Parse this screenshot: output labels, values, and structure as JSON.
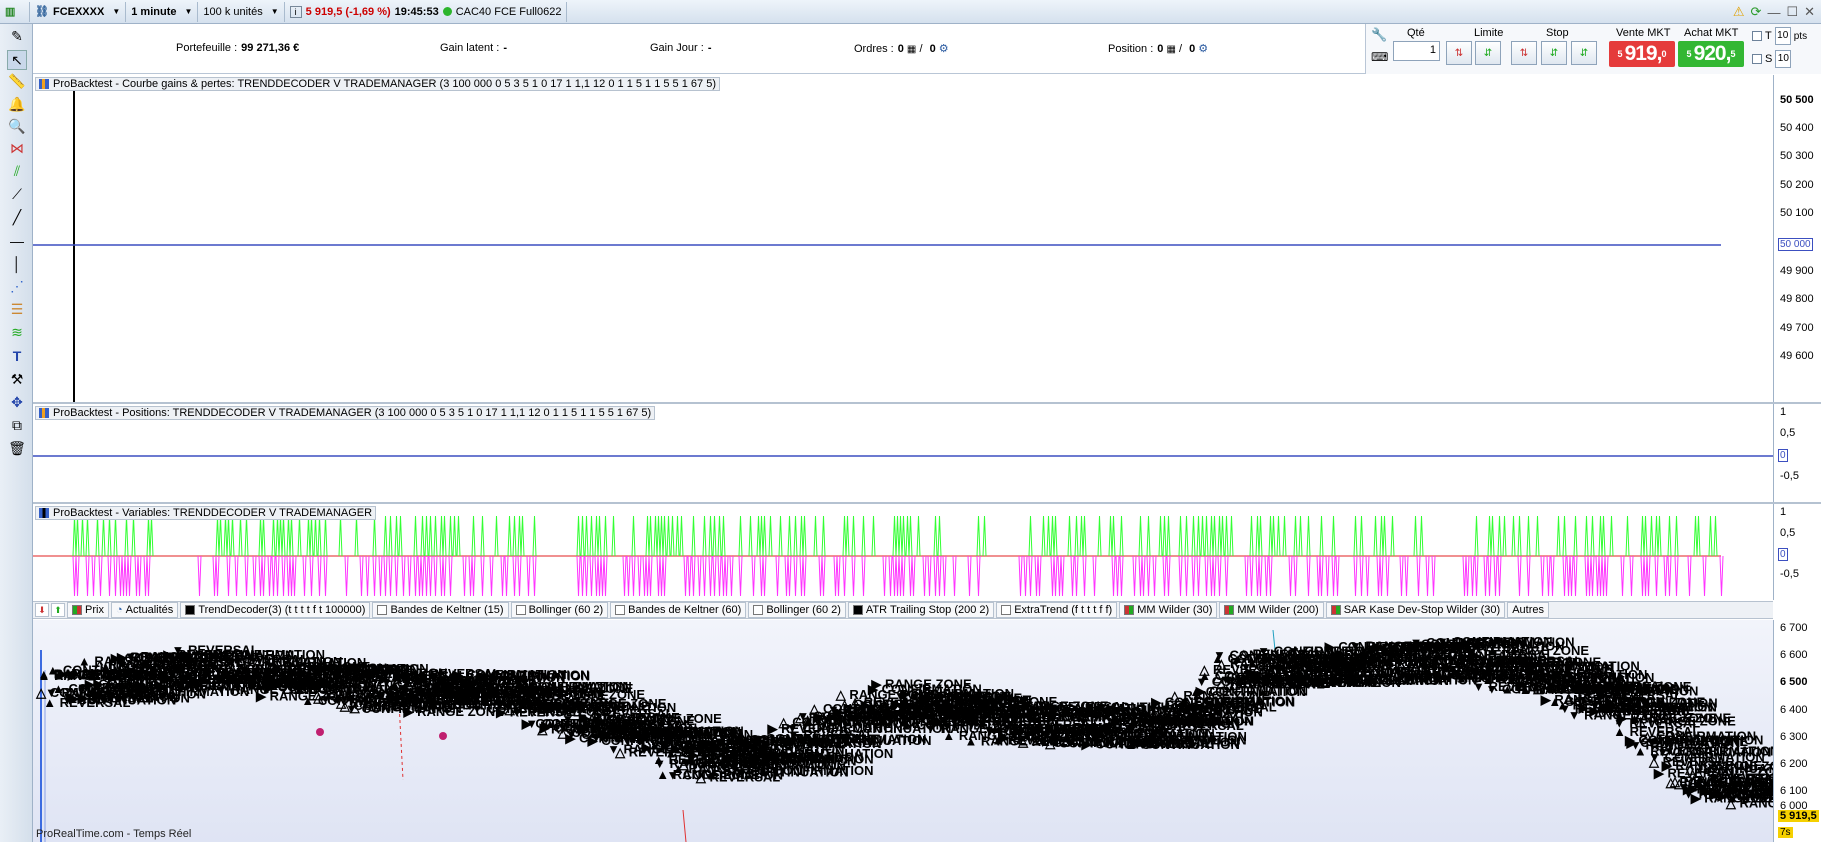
{
  "topbar": {
    "symbol": "FCEXXXX",
    "timeframe": "1 minute",
    "units": "100 k unités",
    "info_icon": "i",
    "price_change": "5 919,5 (-1,69 %)",
    "time": "19:45:53",
    "instrument": "CAC40 FCE Full0622"
  },
  "infobar": {
    "portefeuille_label": "Portefeuille :",
    "portefeuille_value": "99 271,36 €",
    "gain_latent_label": "Gain latent :",
    "gain_latent_value": "-",
    "gain_jour_label": "Gain Jour :",
    "gain_jour_value": "-",
    "ordres_label": "Ordres :",
    "ordres_value_1": "0",
    "ordres_sep": "/",
    "ordres_value_2": "0",
    "position_label": "Position :",
    "position_value_1": "0",
    "position_sep": "/",
    "position_value_2": "0"
  },
  "order_panel": {
    "qty_label": "Qté",
    "qty_value": "1",
    "limit_label": "Limite",
    "stop_label": "Stop",
    "sell_label": "Vente MKT",
    "sell_prefix": "5",
    "sell_main": "919,",
    "sell_sup": "0",
    "buy_label": "Achat MKT",
    "buy_prefix": "5",
    "buy_main": "920,",
    "buy_sup": "5",
    "t_label": "T",
    "s_label": "S",
    "t_value": "10",
    "s_value": "10",
    "pts_label": "pts"
  },
  "panels": {
    "equity": {
      "title": "ProBacktest - Courbe gains & pertes: TRENDDECODER V TRADEMANAGER (3 100 000 0 5 3 5 1 0 17 1 1,1 12 0 1 1 5 1 1 5 5 1 67 5)",
      "ticks": [
        "50 500",
        "50 400",
        "50 300",
        "50 200",
        "50 100",
        "50 000",
        "49 900",
        "49 800",
        "49 700",
        "49 600"
      ],
      "current_value": "50 000"
    },
    "positions": {
      "title": "ProBacktest - Positions: TRENDDECODER V TRADEMANAGER (3 100 000 0 5 3 5 1 0 17 1 1,1 12 0 1 1 5 1 1 5 5 1 67 5)",
      "ticks": [
        "1",
        "0,5",
        "-0,5"
      ],
      "current_value": "0"
    },
    "variables": {
      "title": "ProBacktest - Variables: TRENDDECODER V TRADEMANAGER",
      "ticks": [
        "1",
        "0,5",
        "-0,5"
      ],
      "current_value": "0"
    },
    "price": {
      "ticks": [
        "6 700",
        "6 600",
        "6 500",
        "6 400",
        "6 300",
        "6 200",
        "6 100",
        "6 000"
      ],
      "last_price": "5 919,5",
      "timer": "7s",
      "labels": [
        "RANGE ZONE",
        "REVERSAL",
        "CONFIRMATION",
        "CONTINUATION",
        "REVERSAL",
        "RANGE ZONE",
        "CONFIRMATION",
        "RANGE ZONE",
        "REVERSAL",
        "CONTINUATION",
        "RANGE ZONE",
        "CONFIRMATION",
        "REVERSAL",
        "RANGE ZONE",
        "CONFIRMATION",
        "REVERSAL",
        "CONTINUATION",
        "RANGE ZONE",
        "REVERSAL",
        "CONFIRMATION"
      ]
    }
  },
  "legend": {
    "items": [
      "Prix",
      "Actualités",
      "TrendDecoder(3) (t t t t f t 100000)",
      "Bandes de Keltner (15)",
      "Bollinger (60 2)",
      "Bandes de Keltner (60)",
      "Bollinger (60 2)",
      "ATR Trailing Stop (200 2)",
      "ExtraTrend (f t t t f f)",
      "MM Wilder (30)",
      "MM Wilder (200)",
      "SAR Kase Dev-Stop Wilder (30)",
      "Autres"
    ]
  },
  "footer": "ProRealTime.com - Temps Réel",
  "colors": {
    "sell": "#e53b3b",
    "buy": "#33b733",
    "equity_line": "#3c4fc0",
    "var_pos": "#33ff33",
    "var_neg": "#ff33ff"
  }
}
